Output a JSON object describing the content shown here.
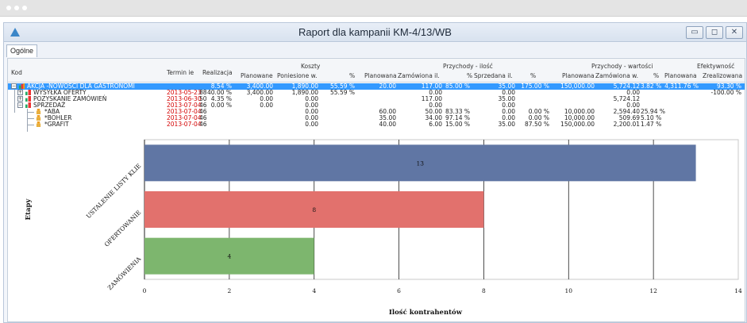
{
  "window": {
    "title": "Raport dla kampanii KM-4/13/WB",
    "tab": "Ogólne",
    "buttons": {
      "minimize": "▭",
      "maximize": "◻",
      "close": "✕"
    }
  },
  "grid": {
    "headers": {
      "kod": "Kod",
      "termin": "Termin ie",
      "realizacja": "Realizacja",
      "koszty": "Koszty",
      "koszty_plan": "Planowane",
      "koszty_pon": "Poniesione w.",
      "koszty_pct": "%",
      "pi_group": "Przychody - ilość",
      "pi_plan": "Planowana",
      "pi_zam": "Zamówiona il.",
      "pi_pct": "%",
      "pi_sprz": "Sprzedana il.",
      "pi_pct2": "%",
      "pw_group": "Przychody - wartości",
      "pw_plan": "Planowana",
      "pw_zam": "Zamówiona w.",
      "pw_pct": "%",
      "ef_group": "Efektywność",
      "ef_plan": "Planowana",
      "ef_zreal": "Zrealizowana"
    },
    "rows": [
      {
        "kod": "AKCJA -NOWOŚCI DLA GASTRONOMI",
        "termin": "",
        "termin_n": "",
        "realizacja": "8.54 %",
        "k_plan": "3,400.00",
        "k_pon": "1,890.00",
        "k_pct": "55.59 %",
        "pi_plan": "20.00",
        "pi_zam": "117.00",
        "pi_pct": "85.00 %",
        "pi_sprz": "35.00",
        "pi_pct2": "175.00 %",
        "pw_plan": "150,000.00",
        "pw_zam": "5,724.12",
        "pw_pct": "3.82 %",
        "ef_plan": "4,311.76 %",
        "ef_zreal": "93.30 %"
      },
      {
        "kod": "WYSYŁKA OFERTY",
        "termin": "2013-05-23",
        "termin_n": "88",
        "realizacja": "40.00 %",
        "k_plan": "3,400.00",
        "k_pon": "1,890.00",
        "k_pct": "55.59 %",
        "pi_plan": "",
        "pi_zam": "0.00",
        "pi_pct": "",
        "pi_sprz": "0.00",
        "pi_pct2": "",
        "pw_plan": "",
        "pw_zam": "0.00",
        "pw_pct": "",
        "ef_plan": "",
        "ef_zreal": "-100.00 %"
      },
      {
        "kod": "POZYSKANIE ZAMÓWIEŃ",
        "termin": "2013-06-30",
        "termin_n": "50",
        "realizacja": "4.35 %",
        "k_plan": "0.00",
        "k_pon": "0.00",
        "k_pct": "",
        "pi_plan": "",
        "pi_zam": "117.00",
        "pi_pct": "",
        "pi_sprz": "35.00",
        "pi_pct2": "",
        "pw_plan": "",
        "pw_zam": "5,724.12",
        "pw_pct": "",
        "ef_plan": "",
        "ef_zreal": ""
      },
      {
        "kod": "SPRZEDAŻ",
        "termin": "2013-07-04",
        "termin_n": "46",
        "realizacja": "0.00 %",
        "k_plan": "0.00",
        "k_pon": "0.00",
        "k_pct": "",
        "pi_plan": "",
        "pi_zam": "0.00",
        "pi_pct": "",
        "pi_sprz": "0.00",
        "pi_pct2": "",
        "pw_plan": "",
        "pw_zam": "0.00",
        "pw_pct": "",
        "ef_plan": "",
        "ef_zreal": ""
      },
      {
        "kod": "*ABA",
        "termin": "2013-07-04",
        "termin_n": "46",
        "realizacja": "",
        "k_plan": "",
        "k_pon": "0.00",
        "k_pct": "",
        "pi_plan": "60.00",
        "pi_zam": "50.00",
        "pi_pct": "83.33 %",
        "pi_sprz": "0.00",
        "pi_pct2": "0.00 %",
        "pw_plan": "10,000.00",
        "pw_zam": "2,594.40",
        "pw_pct": "25.94 %",
        "ef_plan": "",
        "ef_zreal": ""
      },
      {
        "kod": "*BOHLER",
        "termin": "2013-07-04",
        "termin_n": "46",
        "realizacja": "",
        "k_plan": "",
        "k_pon": "0.00",
        "k_pct": "",
        "pi_plan": "35.00",
        "pi_zam": "34.00",
        "pi_pct": "97.14 %",
        "pi_sprz": "0.00",
        "pi_pct2": "0.00 %",
        "pw_plan": "10,000.00",
        "pw_zam": "509.69",
        "pw_pct": "5.10 %",
        "ef_plan": "",
        "ef_zreal": ""
      },
      {
        "kod": "*GRAFIT",
        "termin": "2013-07-04",
        "termin_n": "46",
        "realizacja": "",
        "k_plan": "",
        "k_pon": "0.00",
        "k_pct": "",
        "pi_plan": "40.00",
        "pi_zam": "6.00",
        "pi_pct": "15.00 %",
        "pi_sprz": "35.00",
        "pi_pct2": "87.50 %",
        "pw_plan": "150,000.00",
        "pw_zam": "2,200.01",
        "pw_pct": "1.47 %",
        "ef_plan": "",
        "ef_zreal": ""
      }
    ]
  },
  "chart_data": {
    "type": "bar",
    "orientation": "horizontal",
    "categories": [
      "USTALENIE LISTY KLIE",
      "OFERTOWANIE",
      "ZAMÓWIENIA"
    ],
    "values": [
      13,
      8,
      4
    ],
    "colors": [
      "#6076a4",
      "#e2716d",
      "#7db66e"
    ],
    "xlabel": "Ilość kontrahentów",
    "ylabel": "Etapy",
    "xlim": [
      0,
      14
    ],
    "xticks": [
      "0",
      "2",
      "4",
      "6",
      "8",
      "10",
      "12",
      "14"
    ],
    "grid": true
  }
}
